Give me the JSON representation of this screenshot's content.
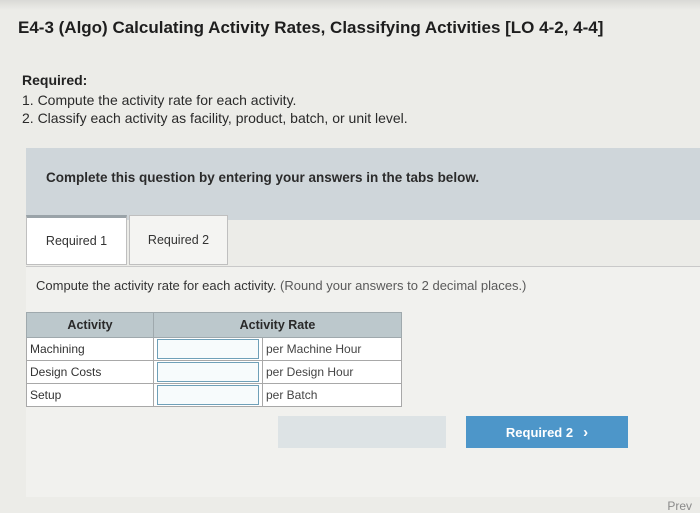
{
  "header": {
    "title": "E4-3 (Algo) Calculating Activity Rates, Classifying Activities [LO 4-2, 4-4]"
  },
  "requirements": {
    "heading": "Required:",
    "items": [
      "1. Compute the activity rate for each activity.",
      "2. Classify each activity as facility, product, batch, or unit level."
    ]
  },
  "banner": {
    "text": "Complete this question by entering your answers in the tabs below."
  },
  "tabs": [
    {
      "label": "Required 1"
    },
    {
      "label": "Required 2"
    }
  ],
  "panel": {
    "instruction": "Compute the activity rate for each activity.",
    "rounding": "(Round your answers to 2 decimal places.)",
    "columns": [
      "Activity",
      "Activity Rate"
    ],
    "rows": [
      {
        "activity": "Machining",
        "rate": "",
        "unit": "per Machine Hour"
      },
      {
        "activity": "Design Costs",
        "rate": "",
        "unit": "per Design Hour"
      },
      {
        "activity": "Setup",
        "rate": "",
        "unit": "per Batch"
      }
    ]
  },
  "nav": {
    "next_label": "Required 2",
    "prev_label": "Prev"
  }
}
